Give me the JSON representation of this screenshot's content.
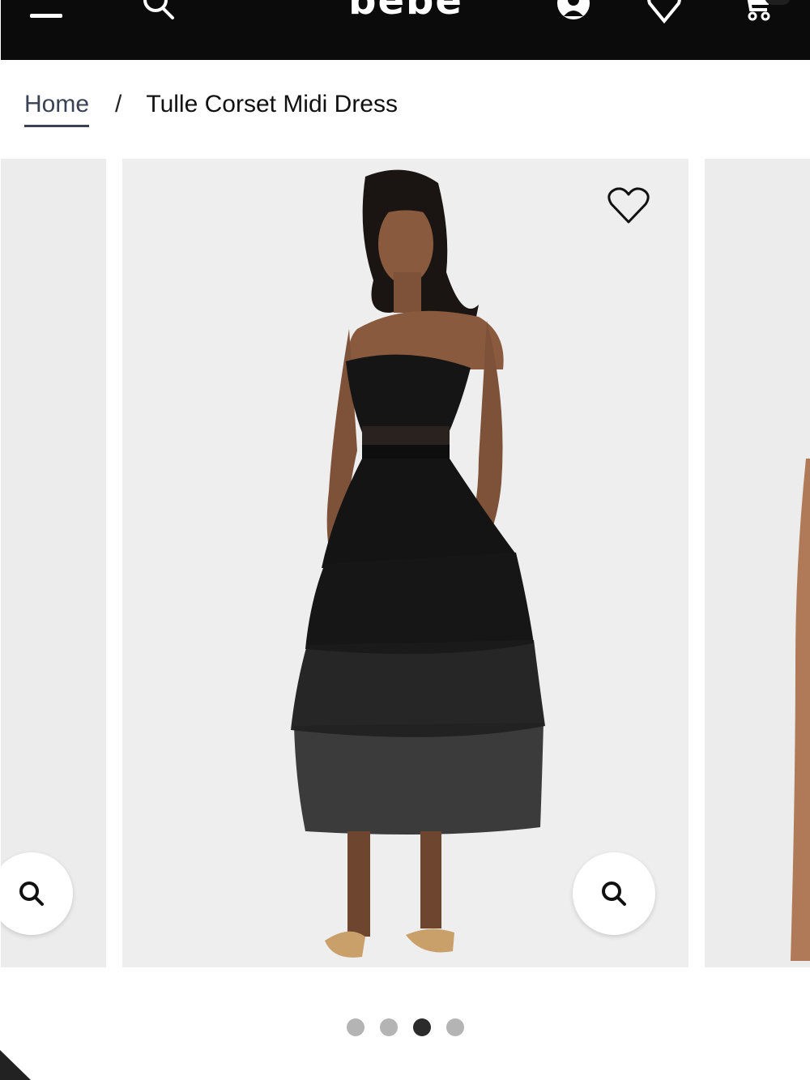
{
  "header": {
    "logo": "bebe",
    "icons": [
      "menu-icon",
      "search-icon",
      "account-icon",
      "wishlist-icon",
      "cart-icon"
    ]
  },
  "breadcrumb": {
    "home": "Home",
    "separator": "/",
    "current": "Tulle Corset Midi Dress"
  },
  "gallery": {
    "slide_count": 4,
    "active_index": 2
  },
  "colors": {
    "header_bg": "#0b0b0b",
    "image_bg": "#eeeeee",
    "dot_active": "#2b2b2b",
    "dot_inactive": "#b4b4b4"
  }
}
